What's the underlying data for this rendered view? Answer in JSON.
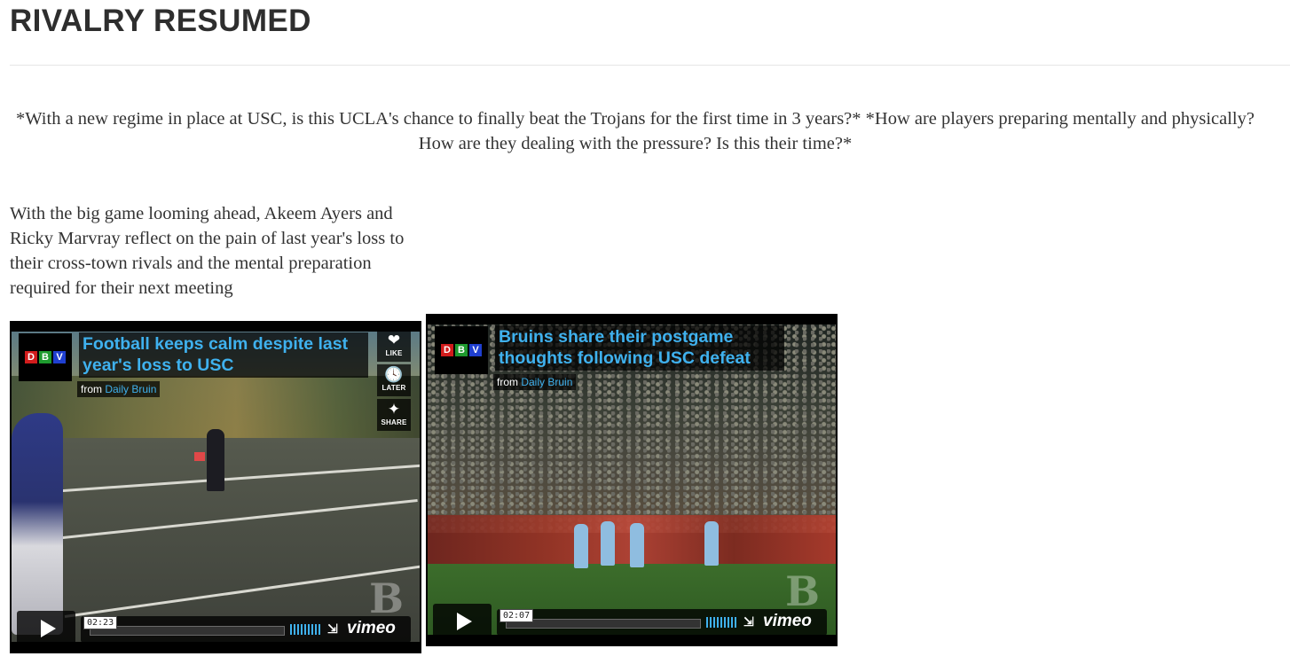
{
  "page": {
    "title": "RIVALRY RESUMED",
    "intro": "*With a new regime in place at USC, is this UCLA's chance to finally beat the Trojans for the first time in 3 years?* *How are players preparing mentally and physically? How are they dealing with the pressure? Is this their time?*",
    "body": "With the big game looming ahead, Akeem Ayers and Ricky Marvray reflect on the pain of last year's loss to their cross-town rivals and the mental preparation required for their next meeting"
  },
  "logo": {
    "d": "D",
    "b": "B",
    "v": "V"
  },
  "videos": [
    {
      "title": "Football keeps calm despite last year's loss to USC",
      "from_label": "from",
      "source": "Daily Bruin",
      "time": "02:23",
      "brand": "vimeo",
      "like_label": "LIKE",
      "later_label": "LATER",
      "share_label": "SHARE"
    },
    {
      "title": "Bruins share their postgame thoughts following USC defeat",
      "from_label": "from",
      "source": "Daily Bruin",
      "time": "02:07",
      "brand": "vimeo"
    }
  ],
  "colors": {
    "accent": "#3fb1ee",
    "logo_red": "#d21c1c",
    "logo_green": "#1e9a2e",
    "logo_blue": "#1f3fd0"
  },
  "icons": [
    "heart-icon",
    "clock-icon",
    "share-icon",
    "play-icon",
    "fullscreen-icon",
    "volume-icon"
  ]
}
